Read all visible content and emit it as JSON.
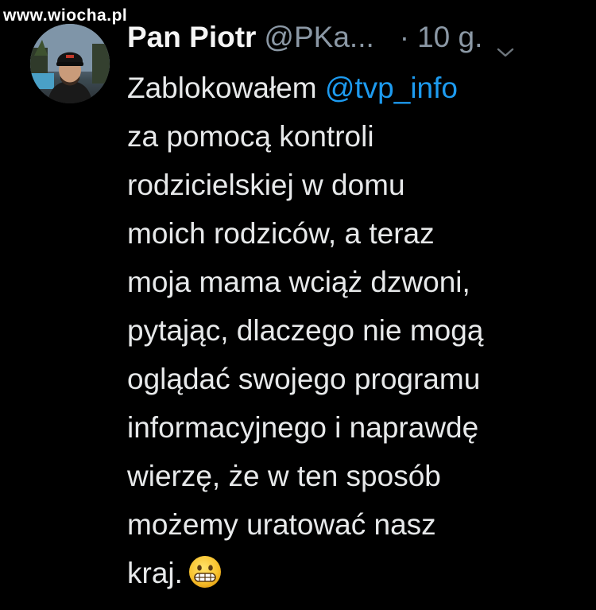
{
  "watermark": "www.wiocha.pl",
  "tweet": {
    "author_name": "Pan Piotr",
    "author_handle": "@PKa...",
    "time_separator": "·",
    "time": "10 g.",
    "menu_icon": "chevron-down-icon",
    "avatar_icon": "avatar",
    "text_lines": {
      "l0_prefix": "Zablokowałem ",
      "l0_mention": "@tvp_info",
      "l1": "za pomocą kontroli",
      "l2": "rodzicielskiej w domu",
      "l3": "moich rodziców, a teraz",
      "l4": "moja mama wciąż dzwoni,",
      "l5": "pytając, dlaczego nie mogą",
      "l6": "oglądać swojego programu",
      "l7": "informacyjnego i naprawdę",
      "l8": "wierzę, że w ten sposób",
      "l9": "możemy uratować nasz",
      "l10": "kraj."
    },
    "emoji": "grimacing-face-emoji"
  },
  "colors": {
    "background": "#000000",
    "text": "#e7e9ea",
    "secondary": "#8b98a5",
    "link": "#1d9bf0"
  }
}
